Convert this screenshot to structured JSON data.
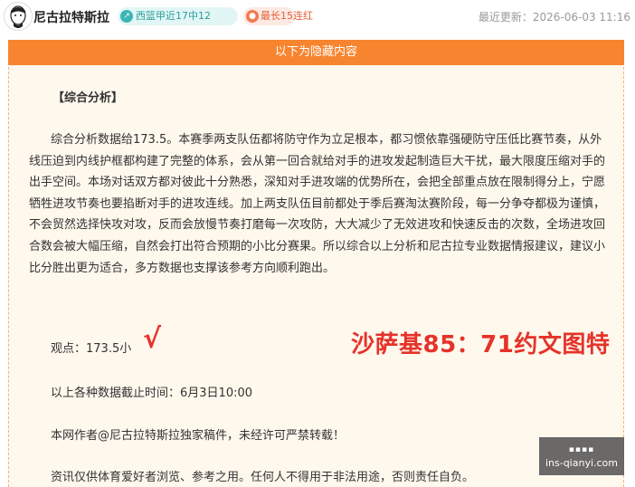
{
  "header": {
    "author": "尼古拉特斯拉",
    "badges": [
      {
        "icon": "trend-icon",
        "text": "西篮甲近17中12",
        "color": "#2a9d9d"
      },
      {
        "icon": "flame-icon",
        "text": "最长15连红",
        "color": "#e2603a"
      }
    ],
    "updated": "最近更新：2026-06-03 11:16"
  },
  "content": {
    "hidden_notice": "以下为隐藏内容",
    "section_title": "【综合分析】",
    "analysis": "综合分析数据给173.5。本赛季两支队伍都将防守作为立足根本，都习惯依靠强硬防守压低比赛节奏，从外线压迫到内线护框都构建了完整的体系，会从第一回合就给对手的进攻发起制造巨大干扰，最大限度压缩对手的出手空间。本场对话双方都对彼此十分熟悉，深知对手进攻端的优势所在，会把全部重点放在限制得分上，宁愿牺牲进攻节奏也要掐断对手的进攻连线。加上两支队伍目前都处于季后赛淘汰赛阶段，每一分争夺都极为谨慎，不会贸然选择快攻对攻，反而会放慢节奏打磨每一次攻防，大大减少了无效进攻和快速反击的次数，全场进攻回合数会被大幅压缩，自然会打出符合预期的小比分赛果。所以综合以上分析和尼古拉专业数据情报建议，建议小比分胜出更为适合，多方数据也支撑该参考方向顺利跑出。",
    "view": "观点：173.5小",
    "check_mark": "√",
    "promo": "沙萨基85：71约文图特",
    "cutoff": "以上各种数据截止时间：6月3日10:00",
    "copyright": "本网作者@尼古拉特斯拉独家稿件，未经许可严禁转载！",
    "disclaimer": "资讯仅供体育爱好者浏览、参考之用。任何人不得用于非法用途，否则责任自负。"
  },
  "watermark": {
    "label": "▪▪▪▪",
    "url": "ins-qianyi.com"
  }
}
